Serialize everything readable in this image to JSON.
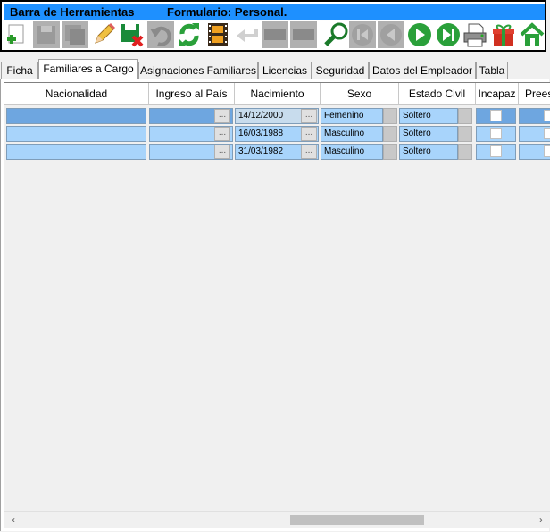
{
  "toolbar": {
    "title": "Barra de Herramientas",
    "form_label": "Formulario: Personal.",
    "buttons": [
      {
        "name": "add-icon",
        "enabled": true
      },
      {
        "name": "save-disabled-icon",
        "enabled": false
      },
      {
        "name": "save-all-disabled-icon",
        "enabled": false
      },
      {
        "name": "edit-pencil-icon",
        "enabled": true
      },
      {
        "name": "delete-save-icon",
        "enabled": true
      },
      {
        "name": "undo-disabled-icon",
        "enabled": false
      },
      {
        "name": "refresh-icon",
        "enabled": true
      },
      {
        "name": "film-icon",
        "enabled": true
      },
      {
        "name": "back-arrow-disabled-icon",
        "enabled": false
      },
      {
        "name": "disabled-button-1",
        "enabled": false
      },
      {
        "name": "disabled-button-2",
        "enabled": false
      },
      {
        "name": "search-icon",
        "enabled": true
      },
      {
        "name": "first-record-disabled-icon",
        "enabled": false
      },
      {
        "name": "previous-record-disabled-icon",
        "enabled": false
      },
      {
        "name": "next-record-icon",
        "enabled": true
      },
      {
        "name": "last-record-icon",
        "enabled": true
      },
      {
        "name": "print-icon",
        "enabled": true
      },
      {
        "name": "gift-icon",
        "enabled": true
      },
      {
        "name": "home-icon",
        "enabled": true
      }
    ]
  },
  "tabs": [
    {
      "label": "Ficha",
      "active": false
    },
    {
      "label": "Familiares a Cargo",
      "active": true
    },
    {
      "label": "Asignaciones Familiares",
      "active": false
    },
    {
      "label": "Licencias",
      "active": false
    },
    {
      "label": "Seguridad",
      "active": false
    },
    {
      "label": "Datos del Empleador",
      "active": false
    },
    {
      "label": "Tabla",
      "active": false
    }
  ],
  "grid": {
    "columns": [
      "Nacionalidad",
      "Ingreso al País",
      "Nacimiento",
      "Sexo",
      "Estado Civil",
      "Incapaz",
      "Prees"
    ],
    "dots_label": "...",
    "rows": [
      {
        "nacionalidad": "",
        "ingreso": "",
        "nacimiento": "14/12/2000",
        "sexo": "Femenino",
        "estado_civil": "Soltero",
        "selected": true
      },
      {
        "nacionalidad": "",
        "ingreso": "",
        "nacimiento": "16/03/1988",
        "sexo": "Masculino",
        "estado_civil": "Soltero",
        "selected": false
      },
      {
        "nacionalidad": "",
        "ingreso": "",
        "nacimiento": "31/03/1982",
        "sexo": "Masculino",
        "estado_civil": "Soltero",
        "selected": false
      }
    ]
  },
  "scrollbar": {
    "left_arrow": "‹",
    "right_arrow": "›"
  }
}
